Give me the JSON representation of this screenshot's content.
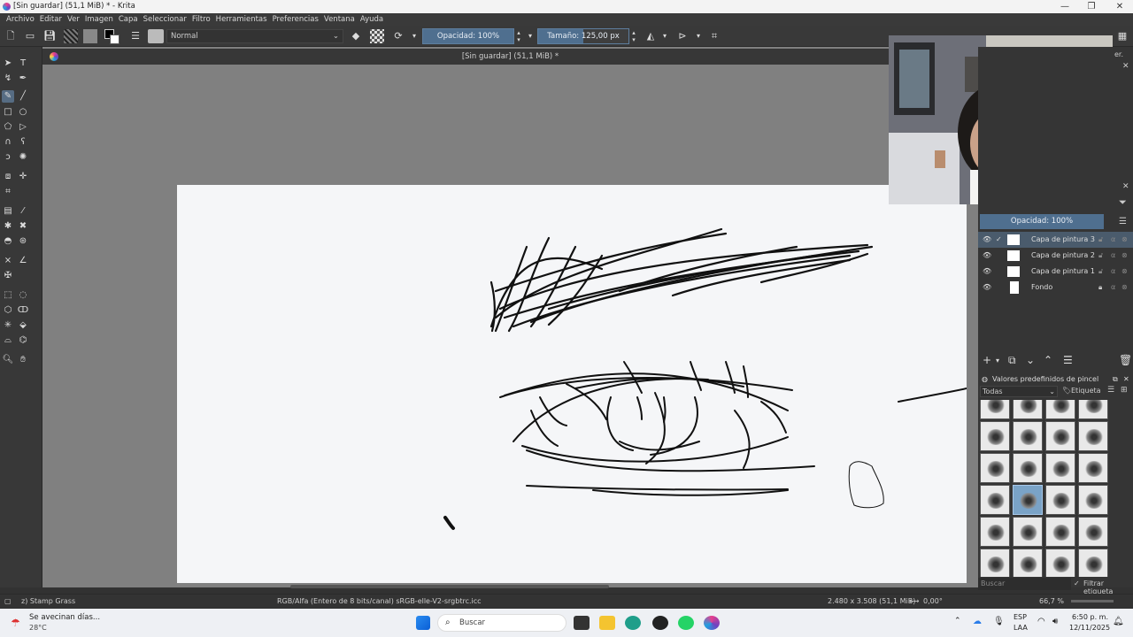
{
  "window": {
    "title": "[Sin guardar]  (51,1 MiB) * - Krita",
    "minimize": "—",
    "maximize": "❐",
    "close": "✕"
  },
  "menu": [
    "Archivo",
    "Editar",
    "Ver",
    "Imagen",
    "Capa",
    "Seleccionar",
    "Filtro",
    "Herramientas",
    "Preferencias",
    "Ventana",
    "Ayuda"
  ],
  "toolbar": {
    "blend_mode": "Normal",
    "opacity": "Opacidad: 100%",
    "size_label": "Tamaño:",
    "size_value": "125,00 px"
  },
  "document_tab": "[Sin guardar]  (51,1 MiB) *",
  "layers_panel": {
    "opacity": "Opacidad:  100%",
    "layers": [
      {
        "name": "Capa de pintura 3",
        "selected": true
      },
      {
        "name": "Capa de pintura 2",
        "selected": false
      },
      {
        "name": "Capa de pintura 1",
        "selected": false
      },
      {
        "name": "Fondo",
        "selected": false
      }
    ]
  },
  "brush_presets": {
    "title": "Valores predefinidos de pincel",
    "filter": "Todas",
    "tag": "Etiqueta",
    "search_placeholder": "Buscar",
    "filter_tag": "Filtrar etiqueta",
    "selected_index": 13
  },
  "statusbar": {
    "brush": "z) Stamp Grass",
    "color_info": "RGB/Alfa (Entero de 8 bits/canal)  sRGB-elle-V2-srgbtrc.icc",
    "doc_size": "2.480 x 3.508 (51,1 MiB)",
    "rotation": "0,00°",
    "zoom": "66,7 %"
  },
  "taskbar": {
    "weather_text": "Se avecinan días...",
    "weather_temp": "28°C",
    "search": "Buscar",
    "lang": "ESP",
    "lang2": "LAA",
    "time": "6:50 p. m.",
    "date": "12/11/2025"
  },
  "colors": {
    "accent": "#4f6f8f",
    "canvas_bg": "#808080",
    "panel": "#353535"
  }
}
